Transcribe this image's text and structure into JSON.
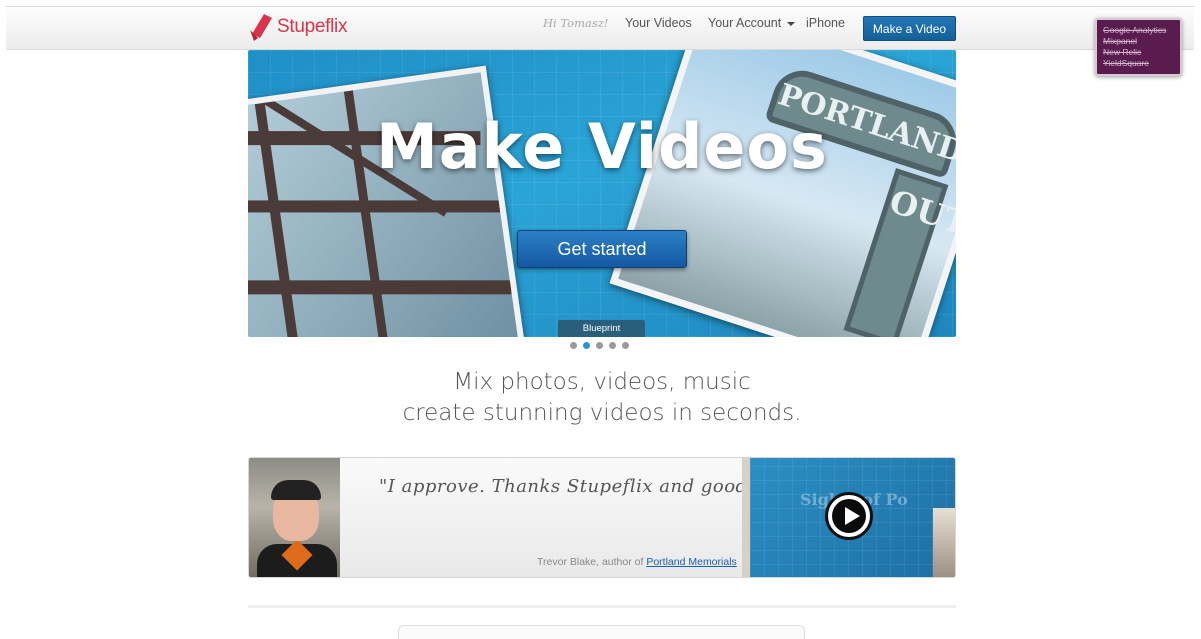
{
  "header": {
    "logo_text": "Stupeflix",
    "greeting": "Hi Tomasz!",
    "nav": {
      "your_videos": "Your Videos",
      "your_account": "Your Account",
      "iphone": "iPhone"
    },
    "make_video_label": "Make a Video",
    "colors": {
      "brand": "#d9344a",
      "primary_button": "#1a6aa8"
    }
  },
  "analytics_badge": {
    "items": [
      "Google Analytics",
      "Mixpanel",
      "New Relic",
      "YieldSquare"
    ],
    "background": "#5a1b4e"
  },
  "hero": {
    "title": "Make Videos",
    "cta_label": "Get started",
    "slide_caption": "Blueprint",
    "sign_text_top": "PORTLAND",
    "sign_text_vertical": "OUT",
    "slide_count": 5,
    "active_slide": 2
  },
  "tagline": {
    "line1": "Mix photos, videos, music",
    "line2": "create stunning videos in seconds."
  },
  "testimonial": {
    "quote": "\"I approve. Thanks Stupeflix and good luck.\"",
    "author": "Trevor Blake, author of ",
    "book_link": "Portland Memorials",
    "video_overlay_text": "Sights of Po"
  }
}
